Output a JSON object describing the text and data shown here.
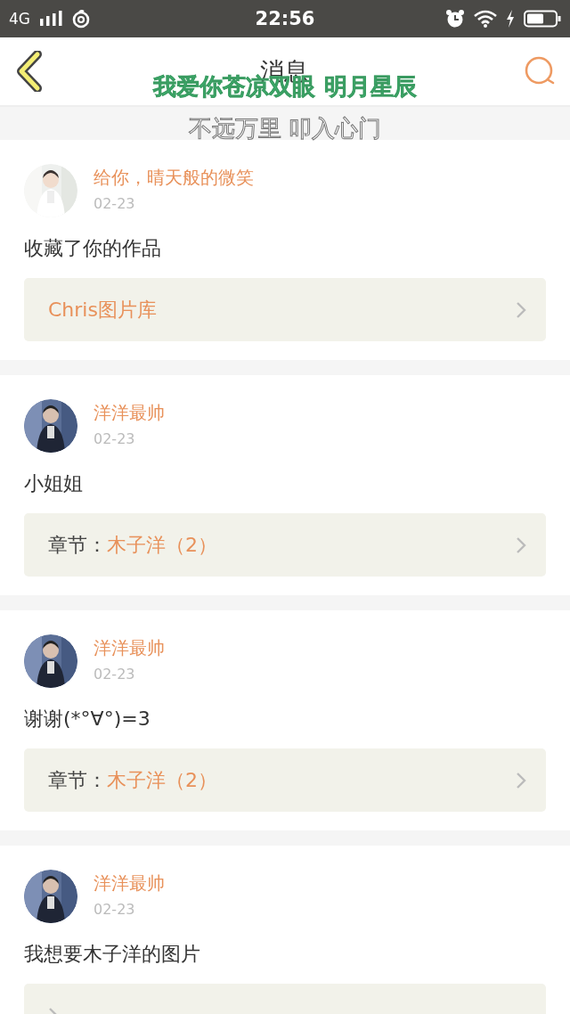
{
  "status_bar": {
    "network": "4G",
    "time": "22:56"
  },
  "header": {
    "title": "消息"
  },
  "lyrics": [
    "我爱你苍凉双眼 明月星辰",
    "不远万里 叩入心门"
  ],
  "messages": [
    {
      "name": "给你，晴天般的微笑",
      "date": "02-23",
      "text": "收藏了你的作品",
      "link": {
        "text": "Chris图片库"
      }
    },
    {
      "name": "洋洋最帅",
      "date": "02-23",
      "text": "小姐姐",
      "link": {
        "prefix": "章节：",
        "text": "木子洋（2）"
      }
    },
    {
      "name": "洋洋最帅",
      "date": "02-23",
      "text": "谢谢(*°∀°)=3",
      "link": {
        "prefix": "章节：",
        "text": "木子洋（2）"
      }
    },
    {
      "name": "洋洋最帅",
      "date": "02-23",
      "text": "我想要木子洋的图片"
    }
  ]
}
